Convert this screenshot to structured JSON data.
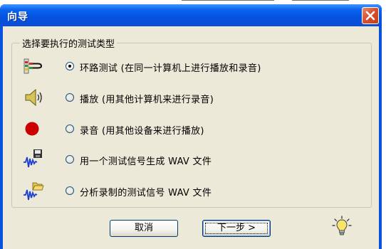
{
  "window": {
    "title": "向导"
  },
  "group": {
    "label": "选择要执行的测试类型"
  },
  "options": [
    {
      "label": "环路测试 (在同一计算机上进行播放和录音)",
      "icon": "loopback-cable-icon",
      "checked": true
    },
    {
      "label": "播放 (用其他计算机来进行录音)",
      "icon": "speaker-icon",
      "checked": false
    },
    {
      "label": "录音 (用其他设备来进行播放)",
      "icon": "record-dot-icon",
      "checked": false
    },
    {
      "label": "用一个测试信号生成 WAV 文件",
      "icon": "waveform-save-icon",
      "checked": false
    },
    {
      "label": "分析录制的测试信号 WAV 文件",
      "icon": "waveform-open-icon",
      "checked": false
    }
  ],
  "buttons": {
    "cancel": "取消",
    "next": "下一步 >"
  },
  "colors": {
    "title_bar": "#0a52de",
    "face": "#ece9d8",
    "close": "#d9522e",
    "record": "#cc0000"
  }
}
